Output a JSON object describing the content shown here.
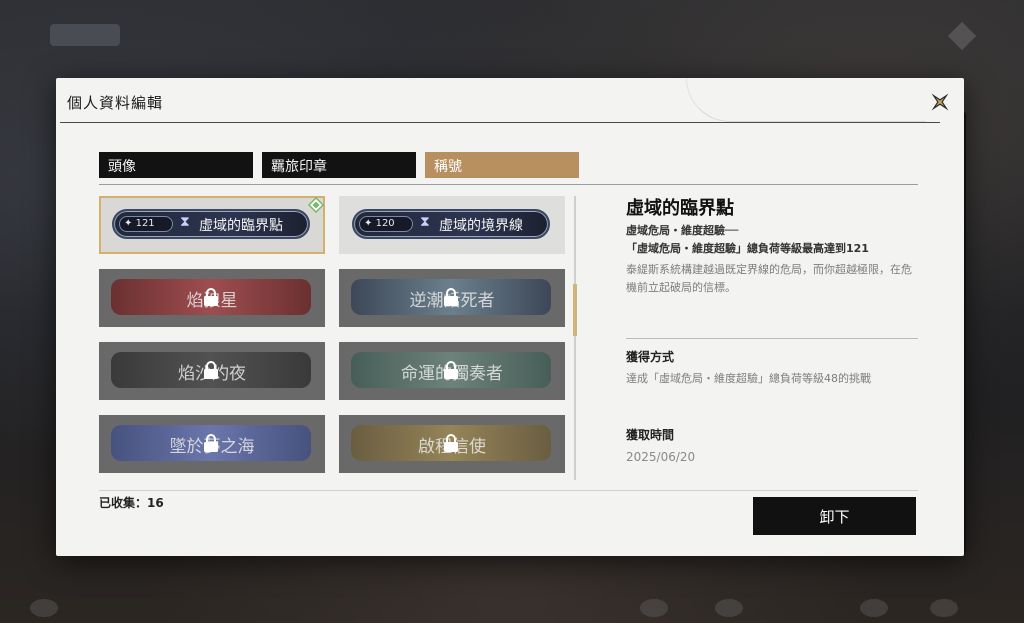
{
  "header": {
    "title": "個人資料編輯"
  },
  "tabs": [
    {
      "label": "頭像",
      "active": false
    },
    {
      "label": "羈旅印章",
      "active": false
    },
    {
      "label": "稱號",
      "active": true
    }
  ],
  "titles": [
    {
      "label": "虛域的臨界點",
      "level": "121",
      "locked": false,
      "selected": true,
      "colors": [
        "#20283a",
        "#2d3550"
      ]
    },
    {
      "label": "虛域的境界線",
      "level": "120",
      "locked": false,
      "selected": false,
      "colors": [
        "#20283a",
        "#2d3550"
      ]
    },
    {
      "label": "焰狼星",
      "locked": true,
      "colors": [
        "#6b1d1f",
        "#b04446"
      ]
    },
    {
      "label": "逆潮話死者",
      "locked": true,
      "colors": [
        "#2e3c52",
        "#6b8799"
      ]
    },
    {
      "label": "焰沙灼夜",
      "locked": true,
      "colors": [
        "#2a2a2a",
        "#4a4a4a"
      ]
    },
    {
      "label": "命運的獨奏者",
      "locked": true,
      "colors": [
        "#3c5a52",
        "#6e8a80"
      ]
    },
    {
      "label": "墜於夢之海",
      "locked": true,
      "colors": [
        "#3b4a86",
        "#6b7ac0"
      ]
    },
    {
      "label": "啟程信使",
      "locked": true,
      "colors": [
        "#6a5a34",
        "#a48d52"
      ]
    }
  ],
  "collected": {
    "text": "已收集：16"
  },
  "detail": {
    "title": "虛域的臨界點",
    "line1": "虛域危局・維度超驗──",
    "line2": "「虛域危局・維度超驗」總負荷等級最高達到121",
    "description": "泰緹斯系統構建越過既定界線的危局，而你超越極限，在危機前立起破局的信標。",
    "obtain_heading": "獲得方式",
    "obtain_text": "達成「虛域危局・維度超驗」總負荷等級48的挑戰",
    "time_heading": "獲取時間",
    "time_value": "2025/06/20"
  },
  "actions": {
    "unequip_label": "卸下"
  },
  "icons": {
    "close": "close-star-icon",
    "lock": "lock-icon",
    "hourglass": "hourglass-icon",
    "equipped": "equipped-diamond-icon"
  },
  "accent": "#b89060"
}
